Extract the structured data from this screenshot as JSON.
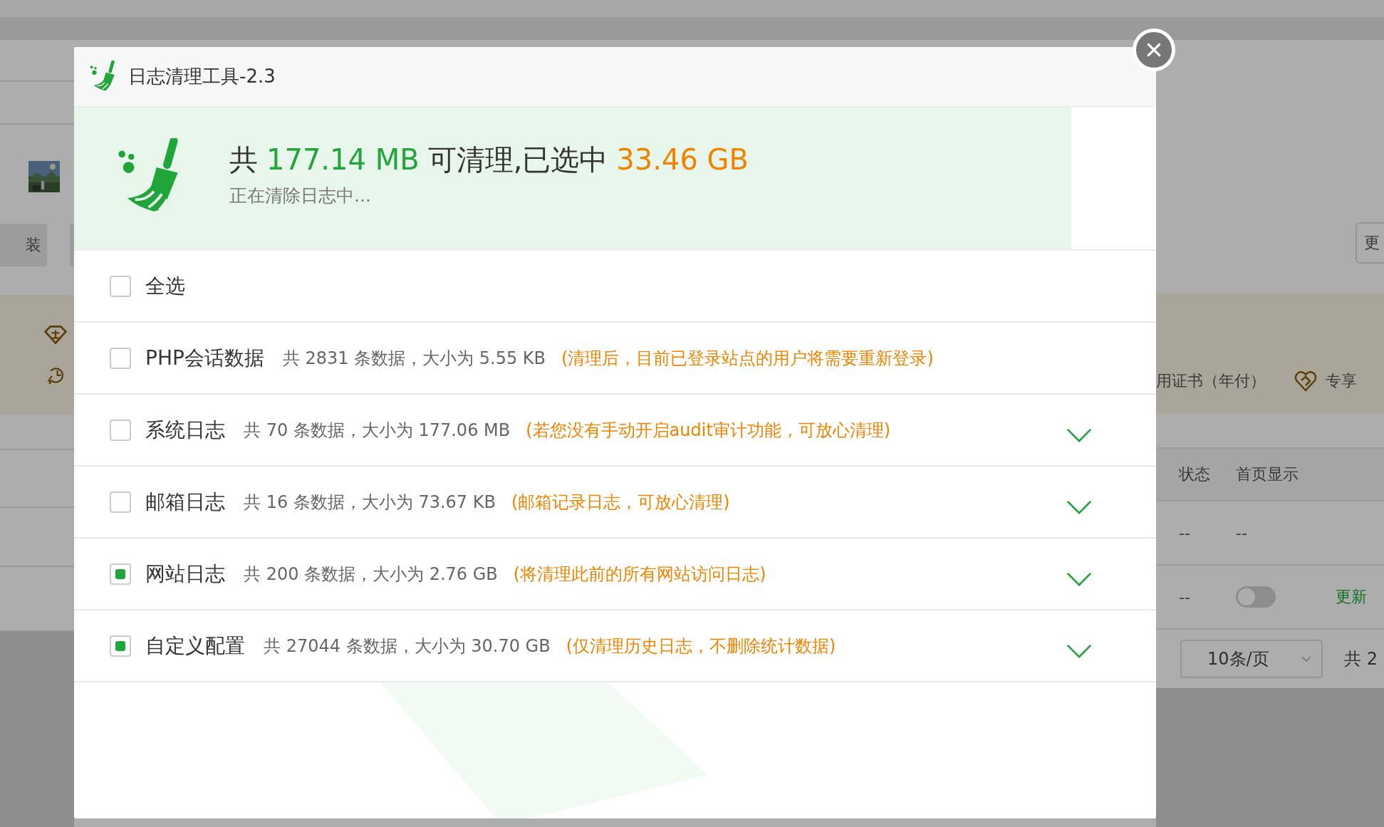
{
  "background": {
    "left": {
      "button": "装"
    },
    "right": {
      "button": "更",
      "promo_items": [
        {
          "label": "用证书（年付）",
          "kind": "text"
        },
        {
          "label": "专享",
          "kind": "heart"
        }
      ],
      "table": {
        "columns": [
          "状态",
          "首页显示"
        ],
        "rows": [
          {
            "kind": "text",
            "status": "--",
            "homepage": "--"
          },
          {
            "kind": "toggle",
            "status": "--",
            "on": false,
            "action": "更新"
          }
        ]
      },
      "pagination": {
        "page_size": "10条/页",
        "total": "共 2"
      }
    }
  },
  "dialog": {
    "title": "日志清理工具-2.3",
    "summary": {
      "prefix": "共",
      "total": "177.14 MB",
      "middle": "可清理,已选中",
      "selected": "33.46 GB",
      "status": "正在清除日志中..."
    },
    "select_all": {
      "label": "全选",
      "checked": false
    },
    "items": [
      {
        "name": "PHP会话数据",
        "info": "共 2831 条数据，大小为 5.55 KB",
        "note": "(清理后，目前已登录站点的用户将需要重新登录)",
        "checked": false,
        "expandable": false
      },
      {
        "name": "系统日志",
        "info": "共 70 条数据，大小为 177.06 MB",
        "note": "(若您没有手动开启audit审计功能，可放心清理)",
        "checked": false,
        "expandable": true
      },
      {
        "name": "邮箱日志",
        "info": "共 16 条数据，大小为 73.67 KB",
        "note": "(邮箱记录日志，可放心清理)",
        "checked": false,
        "expandable": true
      },
      {
        "name": "网站日志",
        "info": "共 200 条数据，大小为 2.76 GB",
        "note": "(将清理此前的所有网站访问日志)",
        "checked": true,
        "expandable": true
      },
      {
        "name": "自定义配置",
        "info": "共 27044 条数据，大小为 30.70 GB",
        "note": "(仅清理历史日志，不删除统计数据)",
        "checked": true,
        "expandable": true
      }
    ]
  }
}
